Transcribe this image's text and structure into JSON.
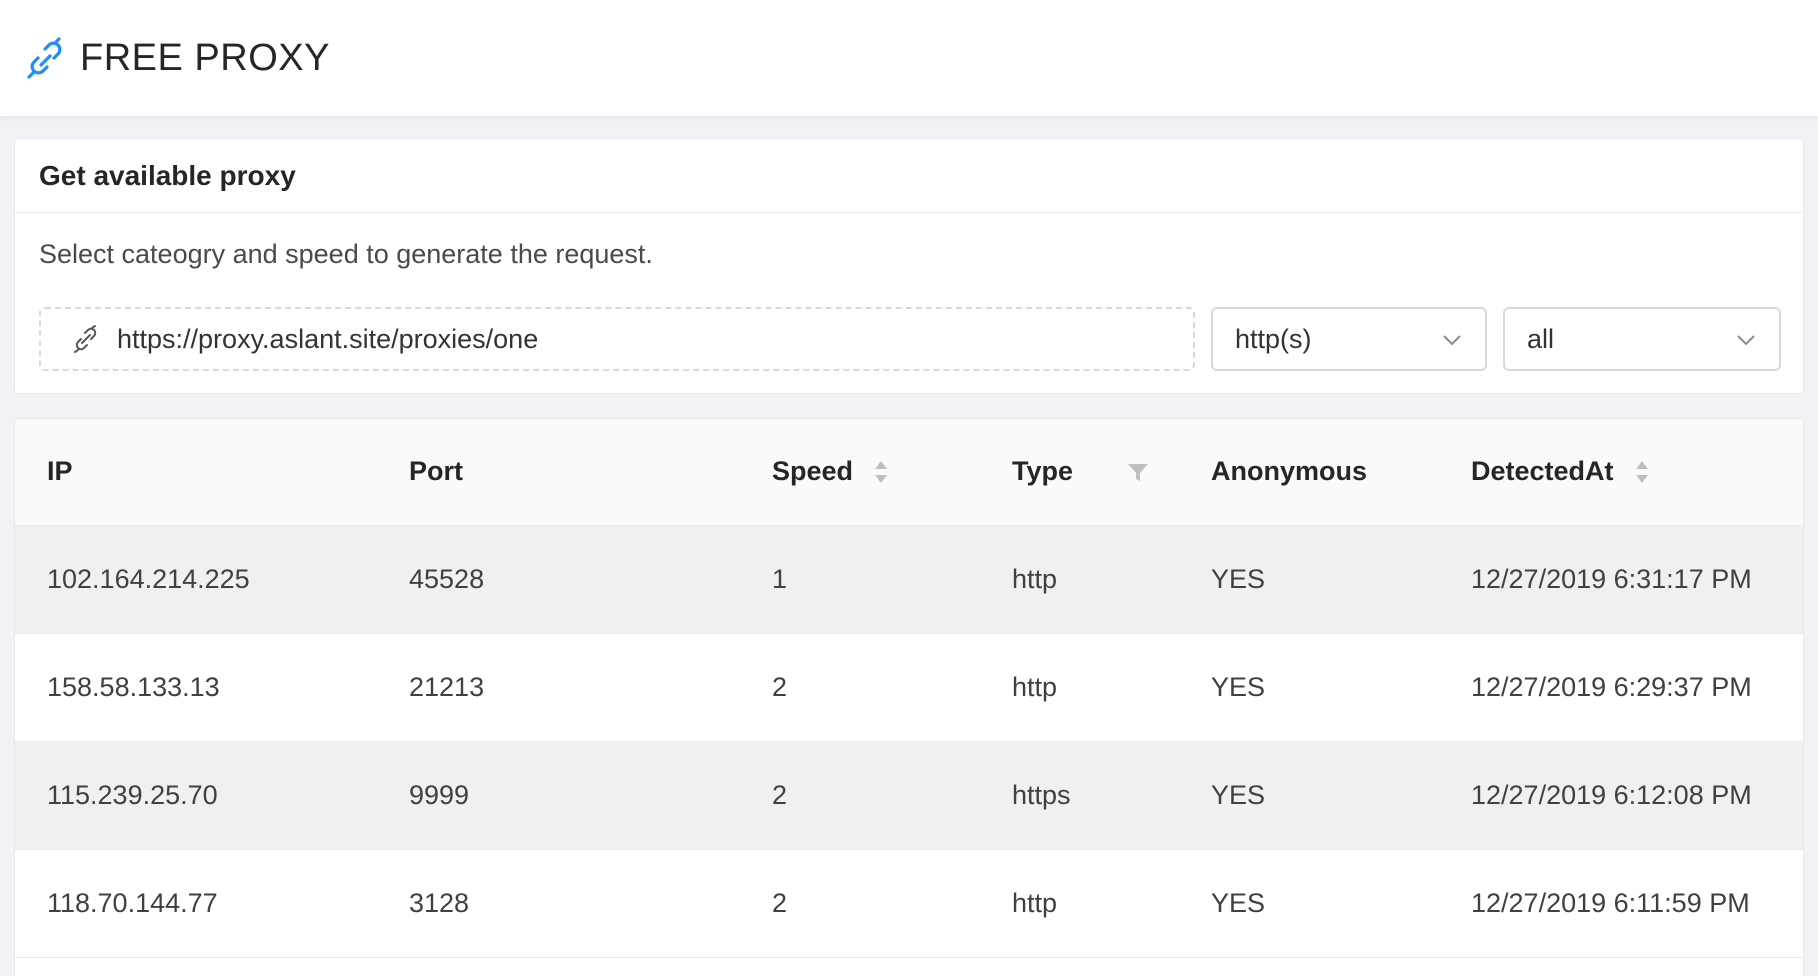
{
  "header": {
    "brand": "FREE PROXY",
    "logo_icon": "link-icon",
    "accent": "#1890ff"
  },
  "card": {
    "title": "Get available proxy",
    "description": "Select cateogry and speed to generate the request.",
    "url": "https://proxy.aslant.site/proxies/one",
    "category_select": "http(s)",
    "speed_select": "all"
  },
  "table": {
    "columns": [
      "IP",
      "Port",
      "Speed",
      "Type",
      "Anonymous",
      "DetectedAt"
    ],
    "rows": [
      {
        "ip": "102.164.214.225",
        "port": "45528",
        "speed": "1",
        "type": "http",
        "anonymous": "YES",
        "detected_at": "12/27/2019 6:31:17 PM"
      },
      {
        "ip": "158.58.133.13",
        "port": "21213",
        "speed": "2",
        "type": "http",
        "anonymous": "YES",
        "detected_at": "12/27/2019 6:29:37 PM"
      },
      {
        "ip": "115.239.25.70",
        "port": "9999",
        "speed": "2",
        "type": "https",
        "anonymous": "YES",
        "detected_at": "12/27/2019 6:12:08 PM"
      },
      {
        "ip": "118.70.144.77",
        "port": "3128",
        "speed": "2",
        "type": "http",
        "anonymous": "YES",
        "detected_at": "12/27/2019 6:11:59 PM"
      }
    ]
  }
}
